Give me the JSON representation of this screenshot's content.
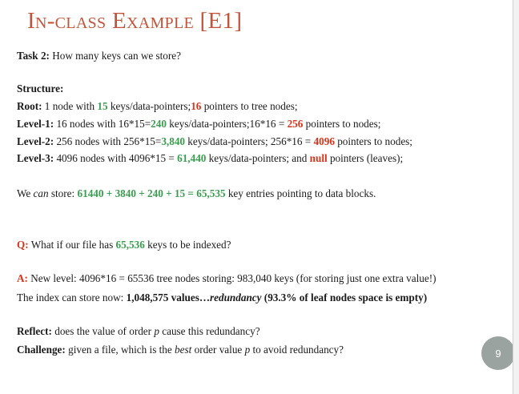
{
  "title": "In-class Example [E1]",
  "task": {
    "label": "Task 2:",
    "text": " How many keys can we store?"
  },
  "structure_heading": "Structure:",
  "root": {
    "label": "Root:",
    "a": " 1 node with ",
    "keys": "15",
    "b": " keys/data-pointers;",
    "ptrs": "16",
    "c": " pointers to tree nodes;"
  },
  "level1": {
    "label": "Level-1:",
    "a": " 16 nodes with 16*15=",
    "keys": "240",
    "b": " keys/data-pointers;16*16 = ",
    "ptrs": "256",
    "c": " pointers to nodes;"
  },
  "level2": {
    "label": "Level-2:",
    "a": " 256 nodes with 256*15=",
    "keys": "3,840",
    "b": " keys/data-pointers; 256*16 = ",
    "ptrs": "4096",
    "c": " pointers to nodes;"
  },
  "level3": {
    "label": "Level-3:",
    "a": " 4096 nodes with 4096*15 = ",
    "keys": "61,440",
    "b": " keys/data-pointers; and ",
    "ptrs": "null",
    "c": " pointers (leaves);"
  },
  "store": {
    "a": "We ",
    "can": "can",
    "b": " store: ",
    "sum": "61440 + 3840 + 240 + 15 = 65,535",
    "c": " key entries pointing to data blocks."
  },
  "question": {
    "label": "Q:",
    "a": " What if our file has ",
    "num": "65,536",
    "b": " keys to be indexed?"
  },
  "answer": {
    "label": "A:",
    "text": " New level: 4096*16 = 65536 tree nodes storing: 983,040 keys (for storing just one extra value!)"
  },
  "index": {
    "a": "The index can store now: ",
    "vals": "1,048,575 values…",
    "red": "redundancy",
    "pct": " (93.3% of leaf nodes space is empty)"
  },
  "reflect": {
    "label": "Reflect:",
    "a": " does the value of order ",
    "p": "p",
    "b": " cause this redundancy?"
  },
  "challenge": {
    "label": "Challenge:",
    "a": " given a file, which is the ",
    "best": "best",
    "b": " order value ",
    "p": "p",
    "c": " to avoid redundancy?"
  },
  "page_number": "9",
  "colors": {
    "title": "#c0553b",
    "green": "#3a9d4f",
    "red": "#d4351c",
    "badge": "#9aa3a0"
  }
}
